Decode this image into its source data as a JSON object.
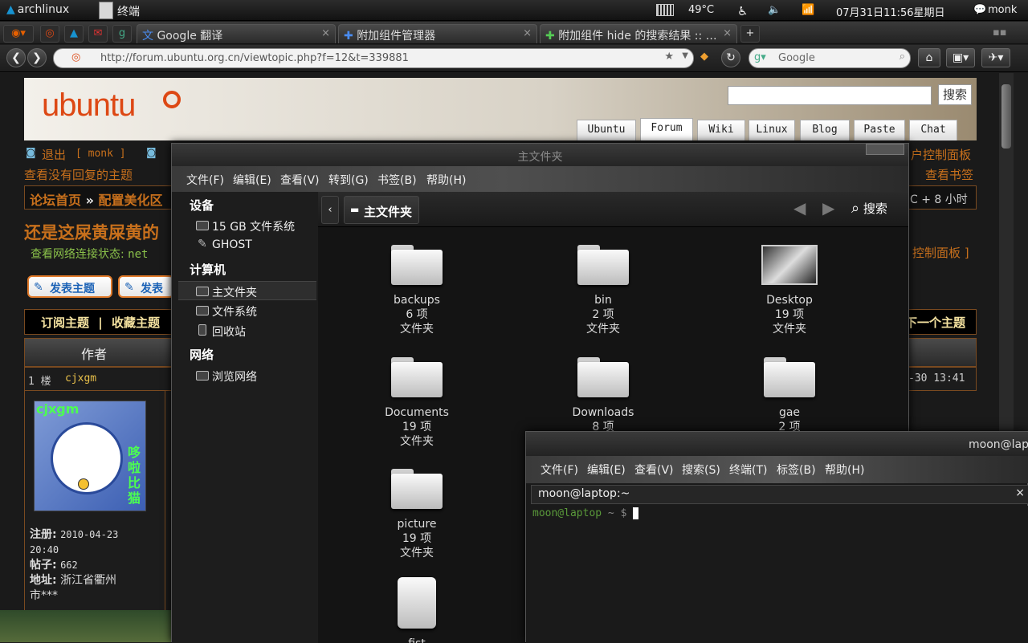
{
  "panel": {
    "distro": "archlinux",
    "task_label": "终端",
    "temperature": "49°C",
    "datetime": "07月31日11:56星期日",
    "user": "monk"
  },
  "browser": {
    "tabs": [
      {
        "label": "Google 翻译"
      },
      {
        "label": "附加组件管理器"
      },
      {
        "label": "附加组件 hide 的搜索结果 :: …"
      }
    ],
    "url": "http://forum.ubuntu.org.cn/viewtopic.php?f=12&t=339881",
    "search_engine": "Google",
    "colors": {
      "ubuntu_orange": "#dd4814",
      "forum_orange": "#c8701c"
    }
  },
  "forum": {
    "logo": "ubuntu",
    "search_button": "搜索",
    "nav_tabs": [
      "Ubuntu",
      "Forum",
      "Wiki",
      "Linux",
      "Blog",
      "Paste",
      "Chat"
    ],
    "active_tab": "Forum",
    "logout": "退出",
    "username": "[ monk ]",
    "unanswered": "查看没有回复的主题",
    "control_panel": "户控制面板",
    "bookmarks": "查看书签",
    "breadcrumb_home": "论坛首页",
    "breadcrumb_section": "配置美化区",
    "timezone": "C + 8 小时",
    "topic_title": "还是这屎黄屎黄的",
    "network_status": "查看网络连接状态:",
    "network_status_tail": "net",
    "control_panel_right": "控制面板 ]",
    "post_button": "发表主题",
    "reply_button": "发表",
    "subscribe": "订阅主题",
    "bookmark_topic": "收藏主题",
    "next_topic": "下一个主题",
    "author_header": "作者",
    "post_floor": "1 楼",
    "post_author": "cjxgm",
    "post_time": "-30 13:41",
    "avatar_name": "cjxgm",
    "avatar_caption": "哆啦比猫",
    "register_label": "注册:",
    "register_date": "2010-04-23",
    "register_time": "20:40",
    "posts_label": "帖子:",
    "posts_count": "662",
    "address_label": "地址:",
    "address_value": "浙江省衢州",
    "address_more": "市***"
  },
  "nautilus": {
    "title": "主文件夹",
    "menu": [
      "文件(F)",
      "编辑(E)",
      "查看(V)",
      "转到(G)",
      "书签(B)",
      "帮助(H)"
    ],
    "sidebar": {
      "devices_header": "设备",
      "devices": [
        "15 GB 文件系统",
        "GHOST"
      ],
      "computer_header": "计算机",
      "computer": [
        "主文件夹",
        "文件系统",
        "回收站"
      ],
      "network_header": "网络",
      "network": [
        "浏览网络"
      ]
    },
    "path_button": "主文件夹",
    "search": "搜索",
    "files": [
      {
        "name": "backups",
        "count": "6 项",
        "type": "文件夹"
      },
      {
        "name": "bin",
        "count": "2 项",
        "type": "文件夹"
      },
      {
        "name": "Desktop",
        "count": "19 项",
        "type": "文件夹"
      },
      {
        "name": "Documents",
        "count": "19 项",
        "type": "文件夹"
      },
      {
        "name": "Downloads",
        "count": "8 项",
        "type": ""
      },
      {
        "name": "gae",
        "count": "2 项",
        "type": ""
      },
      {
        "name": "picture",
        "count": "19 项",
        "type": "文件夹"
      },
      {
        "name": "fist",
        "count": "",
        "type": ""
      }
    ]
  },
  "terminal": {
    "title": "moon@lap",
    "menu": [
      "文件(F)",
      "编辑(E)",
      "查看(V)",
      "搜索(S)",
      "终端(T)",
      "标签(B)",
      "帮助(H)"
    ],
    "tab_label": "moon@laptop:~",
    "prompt_user": "moon@laptop",
    "prompt_path": "~ $"
  }
}
